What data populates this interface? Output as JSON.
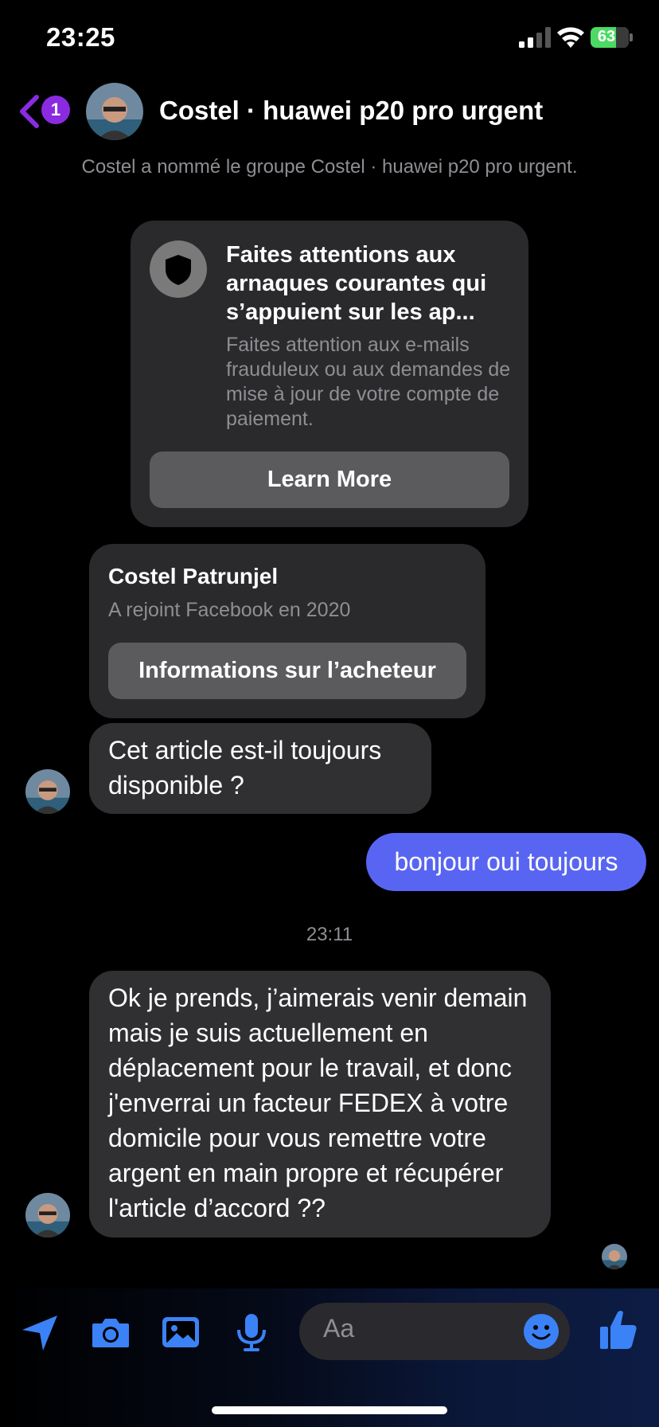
{
  "status_bar": {
    "time": "23:25",
    "battery": "63"
  },
  "header": {
    "back_badge": "1",
    "title": "Costel · huawei p20 pro urgent",
    "system_note": "Costel a nommé le groupe Costel · huawei p20 pro urgent."
  },
  "safety_card": {
    "title": "Faites attentions aux arnaques courantes qui s’appuient sur les ap...",
    "body": "Faites attention aux e-mails frauduleux ou aux demandes de mise à jour de votre compte de paiement.",
    "button": "Learn More"
  },
  "buyer_card": {
    "name": "Costel Patrunjel",
    "joined": "A rejoint Facebook en 2020",
    "button": "Informations sur l’acheteur"
  },
  "messages": [
    {
      "from": "them",
      "text": "Cet article est-il toujours disponible ?"
    },
    {
      "from": "me",
      "text": "bonjour oui toujours"
    },
    {
      "from": "them",
      "text": "Ok je prends, j’aimerais venir demain mais je suis actuellement en déplacement pour le travail, et donc j'enverrai un facteur FEDEX à votre domicile pour vous remettre votre argent en main propre et récupérer l'article d’accord ??"
    }
  ],
  "timestamp": "23:11",
  "composer": {
    "placeholder": "Aa",
    "icons": [
      "location-arrow-icon",
      "camera-icon",
      "photo-icon",
      "microphone-icon",
      "emoji-icon",
      "thumbs-up-icon"
    ],
    "accent": "#3b82f6"
  },
  "colors": {
    "outgoing_bubble": "#5865f2",
    "back_accent": "#8a2be2"
  }
}
